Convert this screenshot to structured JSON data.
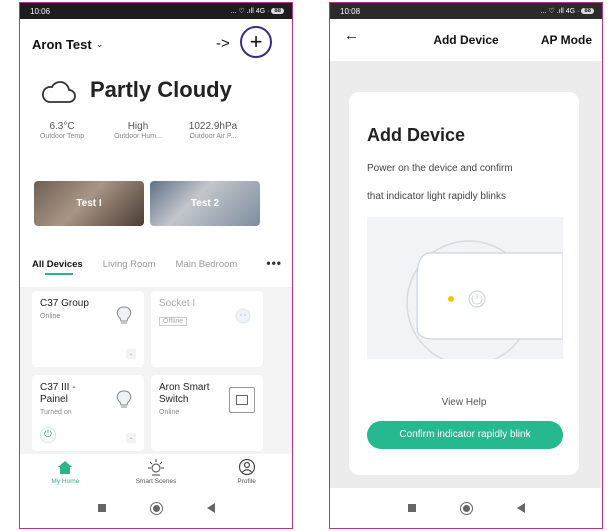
{
  "left_screen": {
    "status": {
      "time": "10:06",
      "icons": "... ♡ .ıll 4G ·",
      "battery": "88"
    },
    "header": {
      "home_name": "Aron Test",
      "arrow_annotation": "->",
      "add_symbol": "+"
    },
    "weather": {
      "condition": "Partly Cloudy",
      "stats": [
        {
          "value": "6.3°C",
          "label": "Outdoor Temp"
        },
        {
          "value": "High",
          "label": "Outdoor Hum..."
        },
        {
          "value": "1022.9hPa",
          "label": "Outdoor Air P..."
        }
      ]
    },
    "rooms": [
      {
        "label": "Test I"
      },
      {
        "label": "Test 2"
      }
    ],
    "tabs": [
      {
        "label": "All Devices"
      },
      {
        "label": "Living Room"
      },
      {
        "label": "Main Bedroom"
      }
    ],
    "more_label": "•••",
    "devices": [
      {
        "name": "C37 Group",
        "status": "Online"
      },
      {
        "name": "Socket I",
        "status": "Offline"
      },
      {
        "name": "C37 III -\nPainel",
        "status": "Turned on"
      },
      {
        "name": "Aron Smart\nSwitch",
        "status": "Online"
      }
    ],
    "bottom_tabs": [
      {
        "label": "My Home",
        "icon": "home-icon"
      },
      {
        "label": "Smart Scenes",
        "icon": "sun-icon"
      },
      {
        "label": "Profile",
        "icon": "profile-icon"
      }
    ],
    "accent_color": "#2bb58a",
    "highlight_color": "#3d2a8a"
  },
  "right_screen": {
    "status": {
      "time": "10:08",
      "icons": "... ♡ .ıll 4G ·",
      "battery": "88"
    },
    "header": {
      "title": "Add Device",
      "mode": "AP Mode",
      "back_symbol": "←"
    },
    "card": {
      "title": "Add Device",
      "desc_line1": "Power on the device and confirm",
      "desc_line2": "that indicator light rapidly blinks",
      "help": "View Help",
      "confirm": "Confirm indicator rapidly blink"
    },
    "button_color": "#26b88f"
  }
}
